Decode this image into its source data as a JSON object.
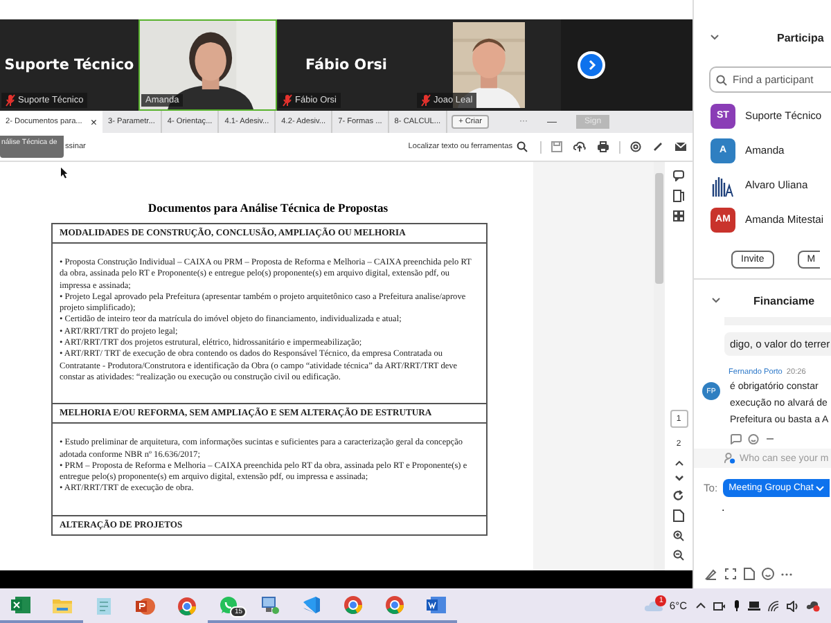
{
  "video_strip": {
    "tiles": [
      {
        "kind": "name",
        "name": "Suporte Técnico",
        "label": "Suporte Técnico",
        "muted": true,
        "speaking": false
      },
      {
        "kind": "video",
        "label": "Amanda",
        "muted": false,
        "speaking": true
      },
      {
        "kind": "name",
        "name": "Fábio Orsi",
        "label": "Fábio Orsi",
        "muted": true,
        "speaking": false
      },
      {
        "kind": "video",
        "label": "Joao Leal",
        "muted": true,
        "speaking": false
      }
    ]
  },
  "pdf_viewer": {
    "tabs": [
      {
        "label": "2- Documentos para...",
        "selected": true
      },
      {
        "label": "3- Parametr...",
        "selected": false
      },
      {
        "label": "4- Orientaç...",
        "selected": false
      },
      {
        "label": "4.1- Adesiv...",
        "selected": false
      },
      {
        "label": "4.2- Adesiv...",
        "selected": false
      },
      {
        "label": "7- Formas ...",
        "selected": false
      },
      {
        "label": "8- CALCUL...",
        "selected": false
      }
    ],
    "close_tab": "×",
    "new_tab": "+ Criar",
    "more": "···",
    "minimize": "—",
    "sign_in": "Sign",
    "tooltip": "nálise Técnica de",
    "toolbar_left": "ssinar",
    "search": "Localizar texto ou ferramentas",
    "document": {
      "title": "Documentos para Análise Técnica de Propostas",
      "sections": [
        {
          "heading": "MODALIDADES DE CONSTRUÇÃO, CONCLUSÃO, AMPLIAÇÃO OU MELHORIA",
          "items": [
            "• Proposta Construção Individual – CAIXA ou PRM – Proposta de Reforma e Melhoria – CAIXA preenchida pelo RT da obra, assinada pelo RT e Proponente(s) e entregue pelo(s) proponente(s) em arquivo digital, extensão pdf, ou impressa e assinada;",
            "• Projeto Legal aprovado pela Prefeitura (apresentar também o projeto arquitetônico caso a Prefeitura analise/aprove projeto simplificado);",
            "• Certidão de inteiro teor da matrícula do imóvel objeto do financiamento, individualizada e atual;",
            "• ART/RRT/TRT do projeto legal;",
            "• ART/RRT/TRT dos projetos estrutural, elétrico, hidrossanitário e impermeabilização;",
            "• ART/RRT/ TRT de execução de obra contendo os dados do Responsável Técnico, da empresa Contratada ou Contratante - Produtora/Construtora e identificação da Obra (o campo “atividade técnica” da ART/RRT/TRT deve constar as atividades: “realização ou execução ou construção civil ou edificação."
          ]
        },
        {
          "heading": "MELHORIA E/OU REFORMA, SEM AMPLIAÇÃO E SEM ALTERAÇÃO DE ESTRUTURA",
          "items": [
            "• Estudo preliminar de arquitetura, com informações sucintas e suficientes para a caracterização geral da concepção adotada conforme NBR nº 16.636/2017;",
            "• PRM – Proposta de Reforma e Melhoria – CAIXA preenchida pelo RT da obra, assinada pelo RT e Proponente(s) e entregue pelo(s) proponente(s) em arquivo digital, extensão pdf, ou impressa e assinada;",
            "• ART/RRT/TRT de execução de obra."
          ]
        },
        {
          "heading": "ALTERAÇÃO DE PROJETOS"
        }
      ]
    },
    "pages": [
      {
        "label": "1",
        "selected": true
      },
      {
        "label": "2",
        "selected": false
      }
    ]
  },
  "participants_panel": {
    "title": "Participa",
    "search": {
      "placeholder": "Find a participant"
    },
    "participants": [
      {
        "kind": "initials",
        "initials": "ST",
        "name": "Suporte Técnico",
        "color": "#8a3db6"
      },
      {
        "kind": "initials",
        "initials": "A",
        "name": "Amanda",
        "color": "#2f7fc1"
      },
      {
        "kind": "logo",
        "name": "Alvaro Uliana"
      },
      {
        "kind": "initials",
        "initials": "AM",
        "name": "Amanda Mitestai",
        "color": "#c9332c"
      }
    ],
    "buttons": [
      "Invite",
      "M"
    ]
  },
  "chat": {
    "title": "Financiame",
    "previous_message": "digo, o valor do terrer",
    "message": {
      "sender": "Fernando Porto",
      "time": "20:26",
      "initials": "FP",
      "lines": [
        "é obrigatório constar",
        "execução no alvará de",
        "Prefeitura ou basta a A"
      ]
    },
    "visibility_notice": "Who can see your m",
    "to_label": "To:",
    "recipient": "Meeting Group Chat",
    "input": "."
  },
  "taskbar": {
    "apps": [
      {
        "kind": "spreadsheet",
        "running": true
      },
      {
        "kind": "folder",
        "running": true
      },
      {
        "kind": "notepad",
        "running": false
      },
      {
        "kind": "presentation",
        "running": false
      },
      {
        "kind": "browser",
        "running": false
      },
      {
        "kind": "chat",
        "running": true,
        "badge": "15"
      },
      {
        "kind": "monitor",
        "running": true
      },
      {
        "kind": "editor",
        "running": true
      },
      {
        "kind": "browser",
        "running": true
      },
      {
        "kind": "browser",
        "running": true
      },
      {
        "kind": "word",
        "running": true
      }
    ],
    "weather": {
      "badge": "1",
      "temperature": "6°C"
    }
  }
}
